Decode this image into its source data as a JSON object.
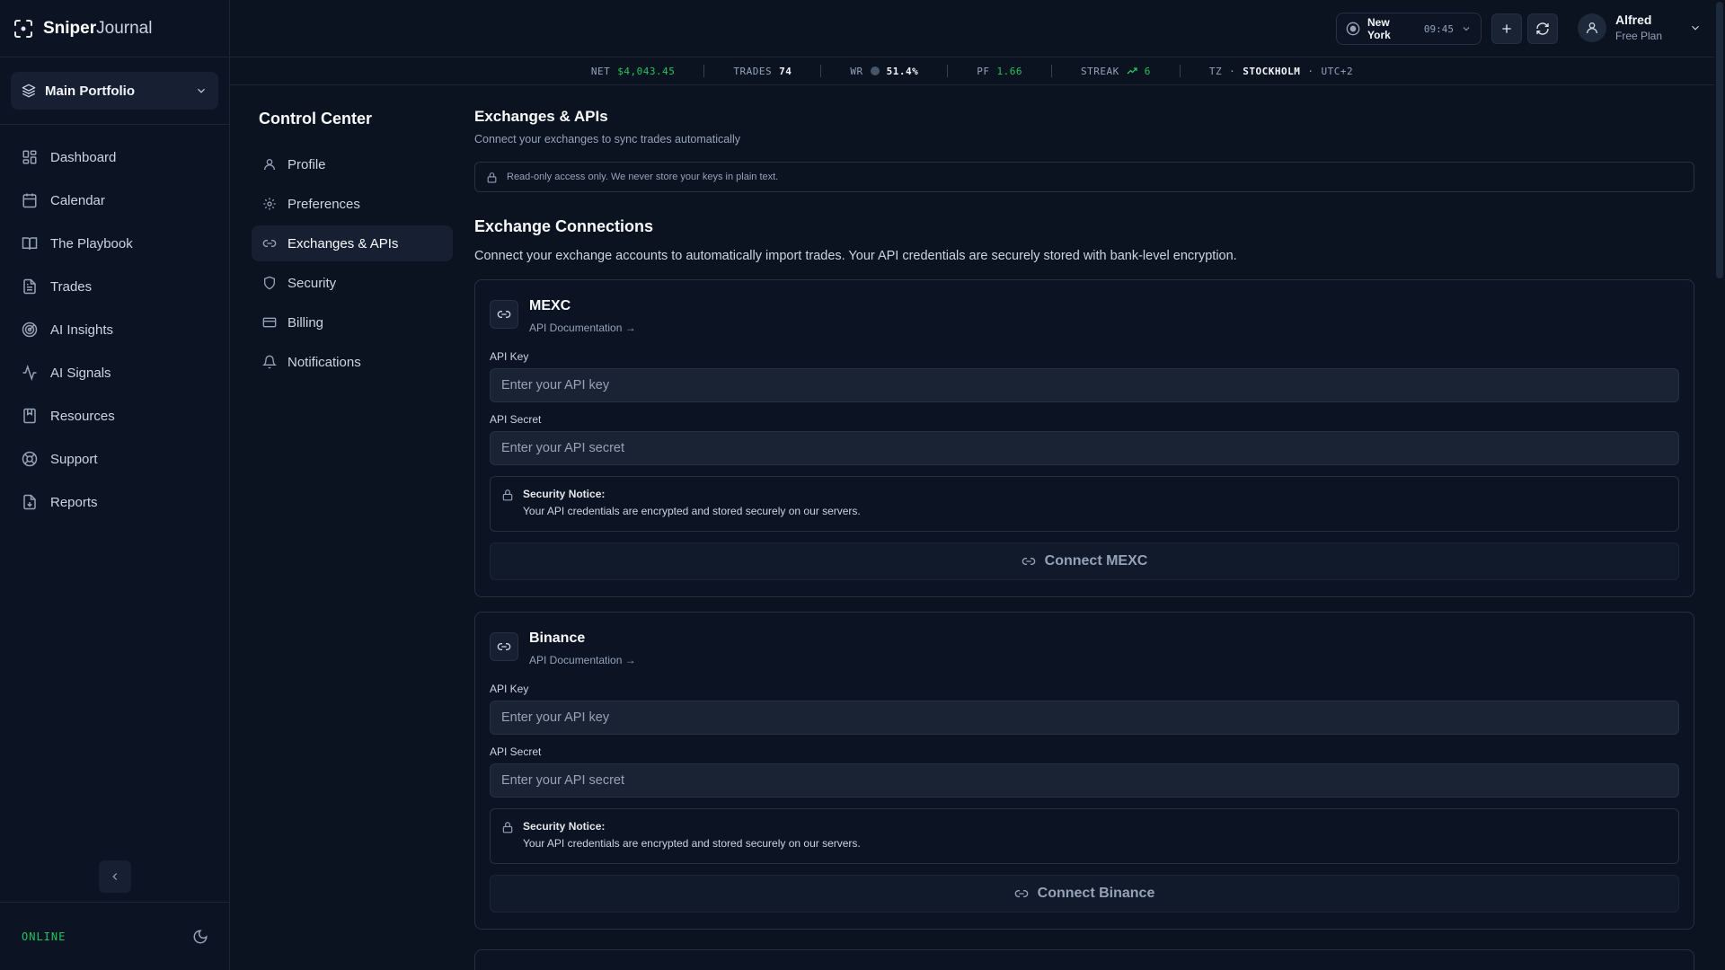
{
  "brand": {
    "name_a": "Sniper",
    "name_b": "Journal"
  },
  "portfolio": {
    "label": "Main Portfolio"
  },
  "sidebar": {
    "items": [
      {
        "label": "Dashboard",
        "icon": "grid-icon"
      },
      {
        "label": "Calendar",
        "icon": "calendar-icon"
      },
      {
        "label": "The Playbook",
        "icon": "book-icon"
      },
      {
        "label": "Trades",
        "icon": "file-icon"
      },
      {
        "label": "AI Insights",
        "icon": "radar-icon"
      },
      {
        "label": "AI Signals",
        "icon": "activity-icon"
      },
      {
        "label": "Resources",
        "icon": "bookmark-icon"
      },
      {
        "label": "Support",
        "icon": "lifebuoy-icon"
      },
      {
        "label": "Reports",
        "icon": "download-file-icon"
      }
    ],
    "status": "ONLINE"
  },
  "header": {
    "city": "New York",
    "time": "09:45",
    "user": {
      "name": "Alfred",
      "plan": "Free Plan"
    }
  },
  "ticker": {
    "net_label": "NET",
    "net_value": "$4,043.45",
    "trades_label": "TRADES",
    "trades_value": "74",
    "wr_label": "WR",
    "wr_value": "51.4%",
    "pf_label": "PF",
    "pf_value": "1.66",
    "streak_label": "STREAK",
    "streak_value": "6",
    "tz_label": "TZ",
    "tz_city": "STOCKHOLM",
    "tz_offset": "UTC+2",
    "colors": {
      "positive": "#22c55e"
    }
  },
  "settings": {
    "title": "Control Center",
    "items": [
      {
        "label": "Profile",
        "icon": "user-icon"
      },
      {
        "label": "Preferences",
        "icon": "gear-icon"
      },
      {
        "label": "Exchanges & APIs",
        "icon": "link-icon",
        "active": true
      },
      {
        "label": "Security",
        "icon": "shield-icon"
      },
      {
        "label": "Billing",
        "icon": "credit-card-icon"
      },
      {
        "label": "Notifications",
        "icon": "bell-icon"
      }
    ]
  },
  "main": {
    "title": "Exchanges & APIs",
    "subtitle": "Connect your exchanges to sync trades automatically",
    "notice": "Read-only access only. We never store your keys in plain text.",
    "section_title": "Exchange Connections",
    "section_sub": "Connect your exchange accounts to automatically import trades. Your API credentials are securely stored with bank-level encryption.",
    "exchanges": [
      {
        "name": "MEXC",
        "doc_link": "API Documentation →",
        "api_key_label": "API Key",
        "api_key_placeholder": "Enter your API key",
        "api_secret_label": "API Secret",
        "api_secret_placeholder": "Enter your API secret",
        "security_title": "Security Notice:",
        "security_text": "Your API credentials are encrypted and stored securely on our servers.",
        "connect_label": "Connect MEXC"
      },
      {
        "name": "Binance",
        "doc_link": "API Documentation →",
        "api_key_label": "API Key",
        "api_key_placeholder": "Enter your API key",
        "api_secret_label": "API Secret",
        "api_secret_placeholder": "Enter your API secret",
        "security_title": "Security Notice:",
        "security_text": "Your API credentials are encrypted and stored securely on our servers.",
        "connect_label": "Connect Binance"
      }
    ]
  }
}
